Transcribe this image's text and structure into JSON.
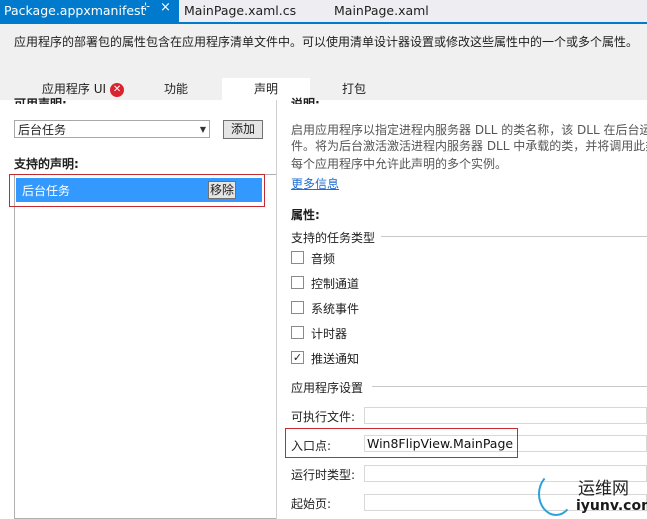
{
  "doc_tabs": [
    "Package.appxmanifest",
    "MainPage.xaml.cs",
    "MainPage.xaml"
  ],
  "doc_tab_pin": "⊹",
  "doc_tab_close": "×",
  "info_text": "应用程序的部署包的属性包含在应用程序清单文件中。可以使用清单设计器设置或修改这些属性中的一个或多个属性。",
  "page_tabs": [
    "应用程序 UI",
    "功能",
    "声明",
    "打包"
  ],
  "page_tab_error_glyph": "✕",
  "left": {
    "available_label": "可用声明:",
    "selected_option": "后台任务",
    "add_button": "添加",
    "supported_label": "支持的声明:",
    "declarations": [
      "后台任务"
    ],
    "remove_button": "移除"
  },
  "right": {
    "desc_heading": "说明:",
    "desc_lines": [
      "启用应用程序以指定进程内服务器 DLL 的类名称，该 DLL 在后台运",
      "件。将为后台激活激活进程内服务器 DLL 中承载的类，并将调用此类",
      "每个应用程序中允许此声明的多个实例。"
    ],
    "more_info": "更多信息",
    "properties_label": "属性:",
    "task_types_label": "支持的任务类型",
    "task_types": [
      {
        "label": "音频",
        "checked": false
      },
      {
        "label": "控制通道",
        "checked": false
      },
      {
        "label": "系统事件",
        "checked": false
      },
      {
        "label": "计时器",
        "checked": false
      },
      {
        "label": "推送通知",
        "checked": true
      }
    ],
    "app_settings_label": "应用程序设置",
    "fields": [
      {
        "label": "可执行文件:",
        "value": ""
      },
      {
        "label": "入口点:",
        "value": "Win8FlipView.MainPage"
      },
      {
        "label": "运行时类型:",
        "value": ""
      },
      {
        "label": "起始页:",
        "value": ""
      }
    ]
  },
  "watermark": {
    "cn": "运维网",
    "en": "iyunv.com"
  },
  "colors": {
    "accent": "#007acc",
    "selection": "#3399ff",
    "highlight_box": "#c42b31",
    "link": "#1e6dcf",
    "error": "#d9232e"
  }
}
